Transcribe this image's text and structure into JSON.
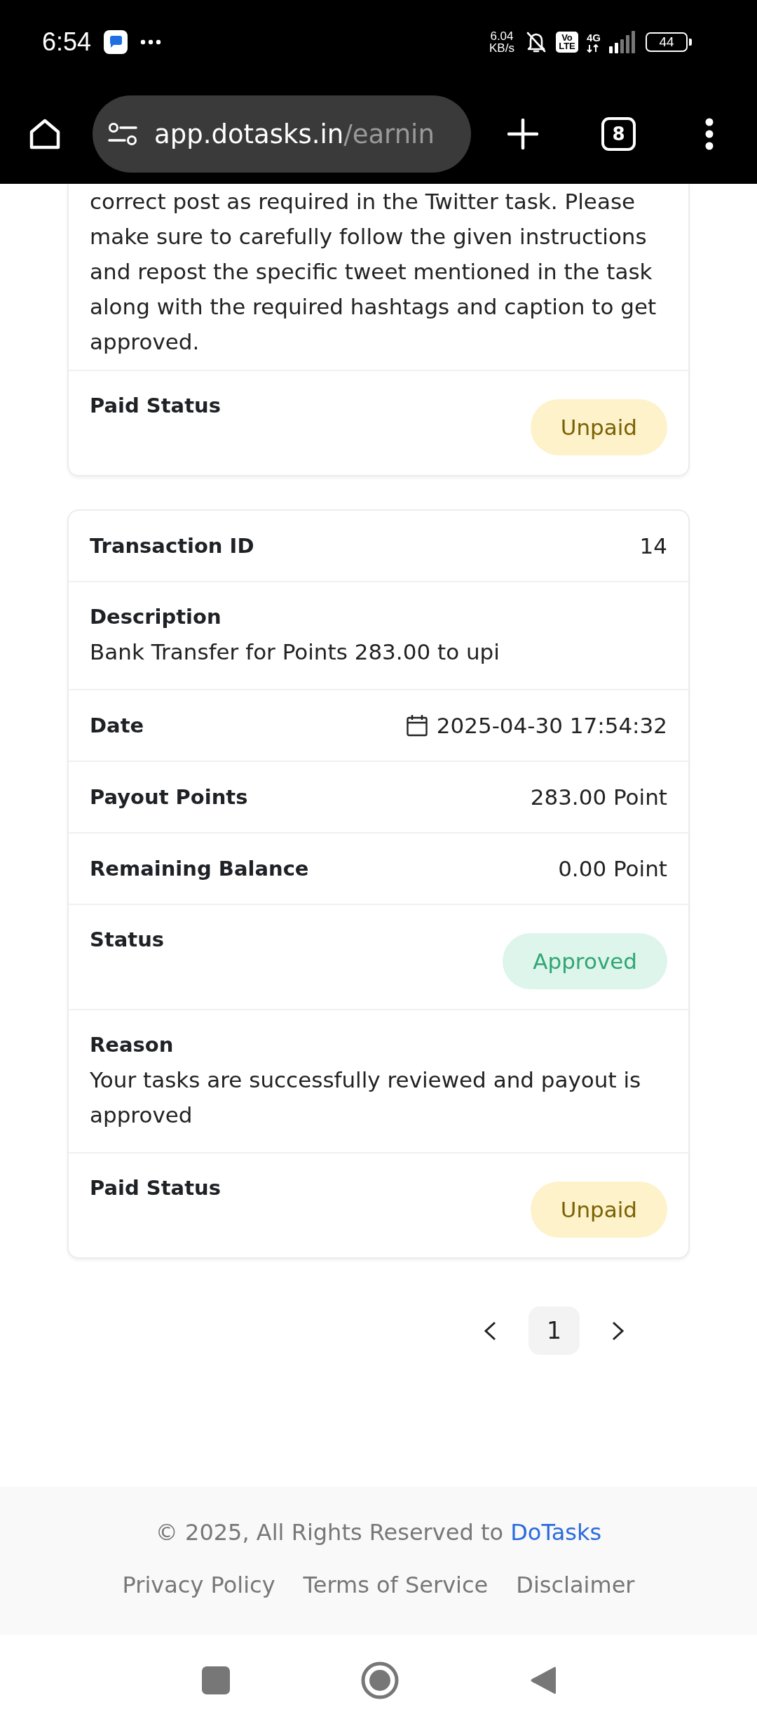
{
  "status_bar": {
    "time": "6:54",
    "network_speed": "6.04 KB/s",
    "volte": "Vo LTE",
    "network_type": "4G",
    "battery": "44"
  },
  "browser_bar": {
    "url_host": "app.dotasks.in",
    "url_path": "/earnin",
    "tab_count": "8"
  },
  "transactions": [
    {
      "fields": [
        {
          "kind": "block",
          "value": "correct post as required in the Twitter task. Please make sure to carefully follow the given instructions and repost the specific tweet mentioned in the task along with the required hashtags and caption to get approved."
        },
        {
          "kind": "badge",
          "label": "Paid Status",
          "value": "Unpaid",
          "color": "#fdf2c9"
        }
      ]
    },
    {
      "fields": [
        {
          "kind": "pair",
          "label": "Transaction ID",
          "value": "14"
        },
        {
          "kind": "block",
          "label": "Description",
          "value": "Bank Transfer for Points 283.00 to upi"
        },
        {
          "kind": "date",
          "label": "Date",
          "value": "2025-04-30 17:54:32"
        },
        {
          "kind": "pair",
          "label": "Payout Points",
          "value": "283.00 Point"
        },
        {
          "kind": "pair",
          "label": "Remaining Balance",
          "value": "0.00 Point"
        },
        {
          "kind": "badge",
          "label": "Status",
          "value": "Approved",
          "color": "#ddf5eb"
        },
        {
          "kind": "block",
          "label": "Reason",
          "value": "Your tasks are successfully reviewed and payout is approved"
        },
        {
          "kind": "badge",
          "label": "Paid Status",
          "value": "Unpaid",
          "color": "#fdf2c9"
        }
      ]
    }
  ],
  "pagination": {
    "pages": [
      {
        "label": "1",
        "selected": true
      }
    ]
  },
  "footer": {
    "copyright": "© 2025, All Rights Reserved to",
    "brand_link": "DoTasks",
    "links": [
      "Privacy Policy",
      "Terms of Service",
      "Disclaimer"
    ]
  }
}
